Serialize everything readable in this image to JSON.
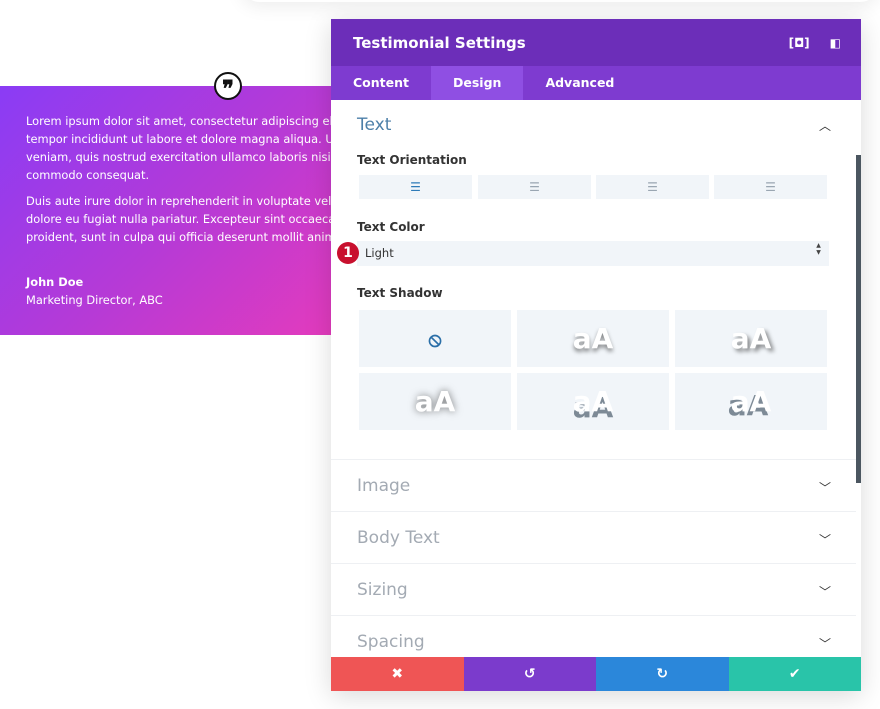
{
  "testimonial": {
    "paragraphs": [
      "Lorem ipsum dolor sit amet, consectetur adipiscing elit\ntempor incididunt ut labore et dolore magna aliqua. Ut\nveniam, quis nostrud exercitation ullamco laboris nisi u\ncommodo consequat.",
      "Duis aute irure dolor in reprehenderit in voluptate velit\ndolore eu fugiat nulla pariatur. Excepteur sint occaecat\nproident, sunt in culpa qui officia deserunt mollit anim"
    ],
    "author": "John Doe",
    "position": "Marketing Director, ABC",
    "quote_glyph": "❞",
    "gradient": [
      "#8a3cf5",
      "#e33bbd"
    ]
  },
  "panel": {
    "title": "Testimonial Settings",
    "tabs": [
      {
        "label": "Content"
      },
      {
        "label": "Design",
        "active": true
      },
      {
        "label": "Advanced"
      }
    ],
    "open_section": {
      "title": "Text",
      "text_orientation_label": "Text Orientation",
      "orientations": [
        "left",
        "center",
        "right",
        "justify"
      ],
      "selected_orientation": "left",
      "text_color_label": "Text Color",
      "text_color_value": "Light",
      "badge": "1",
      "text_shadow_label": "Text Shadow",
      "shadow_sample": "aA",
      "selected_shadow": "none"
    },
    "sections": [
      "Image",
      "Body Text",
      "Sizing",
      "Spacing"
    ],
    "footer": {
      "cancel": "✖",
      "undo": "↺",
      "redo": "↻",
      "save": "✔"
    },
    "colors": {
      "header": "#6c2eb9",
      "tabs": "#7e3bd0",
      "cancel": "#ef5555",
      "undo": "#7b3bcc",
      "redo": "#2b87da",
      "save": "#29c4a9"
    }
  }
}
